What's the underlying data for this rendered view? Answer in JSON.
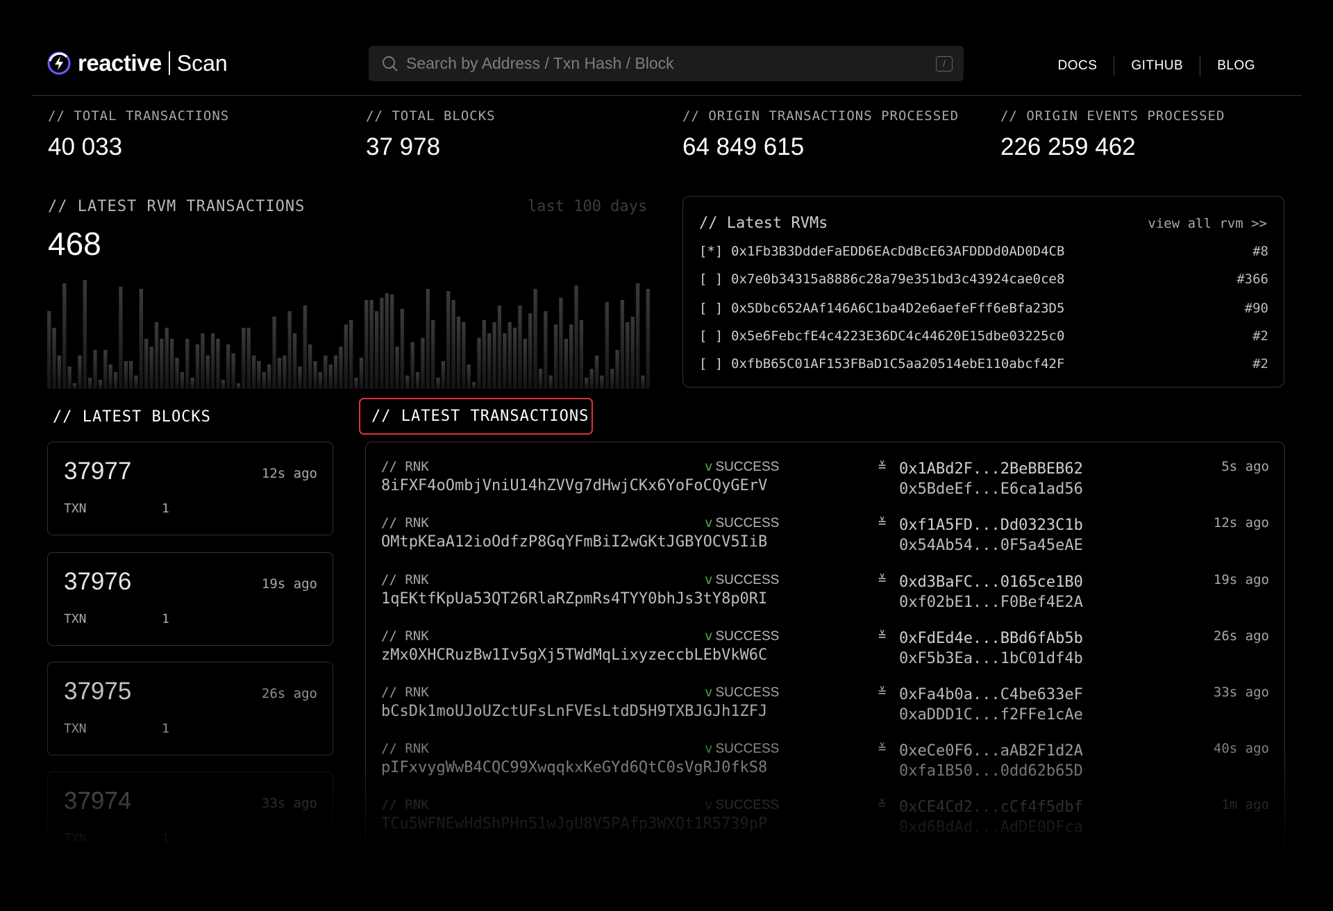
{
  "brand": {
    "name": "reactive",
    "product": "Scan"
  },
  "search": {
    "placeholder": "Search by Address / Txn Hash / Block",
    "shortcut": "/"
  },
  "nav": [
    "DOCS",
    "GITHUB",
    "BLOG"
  ],
  "stats": [
    {
      "label": "// TOTAL TRANSACTIONS",
      "value": "40 033"
    },
    {
      "label": "// TOTAL BLOCKS",
      "value": "37 978"
    },
    {
      "label": "// ORIGIN TRANSACTIONS PROCESSED",
      "value": "64 849 615"
    },
    {
      "label": "// ORIGIN EVENTS PROCESSED",
      "value": "226 259 462"
    }
  ],
  "rvm_tx": {
    "title": "// LATEST RVM TRANSACTIONS",
    "range": "last 100 days",
    "count": "468",
    "bars": [
      0.7,
      0.55,
      0.3,
      0.95,
      0.2,
      0.05,
      0.3,
      0.98,
      0.1,
      0.35,
      0.08,
      0.35,
      0.22,
      0.15,
      0.92,
      0.25,
      0.25,
      0.12,
      0.9,
      0.45,
      0.38,
      0.6,
      0.45,
      0.55,
      0.45,
      0.28,
      0.15,
      0.45,
      0.1,
      0.4,
      0.5,
      0.3,
      0.5,
      0.45,
      0.08,
      0.4,
      0.32,
      0.05,
      0.55,
      0.55,
      0.3,
      0.25,
      0.15,
      0.22,
      0.65,
      0.28,
      0.3,
      0.7,
      0.5,
      0.2,
      0.75,
      0.4,
      0.25,
      0.15,
      0.3,
      0.22,
      0.3,
      0.38,
      0.58,
      0.62,
      0.1,
      0.28,
      0.8,
      0.8,
      0.7,
      0.82,
      0.86,
      0.85,
      0.38,
      0.72,
      0.12,
      0.42,
      0.15,
      0.46,
      0.9,
      0.62,
      0.1,
      0.25,
      0.88,
      0.8,
      0.65,
      0.6,
      0.22,
      0.06,
      0.46,
      0.62,
      0.5,
      0.6,
      0.75,
      0.5,
      0.6,
      0.55,
      0.75,
      0.45,
      0.68,
      0.9,
      0.18,
      0.7,
      0.12,
      0.58,
      0.82,
      0.45,
      0.58,
      0.93,
      0.62,
      0.1,
      0.18,
      0.3,
      0.12,
      0.78,
      0.18,
      0.35,
      0.8,
      0.6,
      0.65,
      0.95,
      0.12,
      0.9
    ]
  },
  "rvms": {
    "title": "// Latest RVMs",
    "view_all": "view all rvm >>",
    "rows": [
      {
        "mark": "[*]",
        "address": "0x1Fb3B3DddeFaEDD6EAcDdBcE63AFDDDd0AD0D4CB",
        "count": "#8"
      },
      {
        "mark": "[ ]",
        "address": "0x7e0b34315a8886c28a79e351bd3c43924cae0ce8",
        "count": "#366"
      },
      {
        "mark": "[ ]",
        "address": "0x5Dbc652AAf146A6C1ba4D2e6aefeFff6eBfa23D5",
        "count": "#90"
      },
      {
        "mark": "[ ]",
        "address": "0x5e6FebcfE4c4223E36DC4c44620E15dbe03225c0",
        "count": "#2"
      },
      {
        "mark": "[ ]",
        "address": "0xfbB65C01AF153FBaD1C5aa20514ebE110abcf42F",
        "count": "#2"
      }
    ]
  },
  "latest_blocks": {
    "title": "// LATEST BLOCKS",
    "txn_label": "TXN",
    "items": [
      {
        "number": "37977",
        "ago": "12s ago",
        "txn": "1"
      },
      {
        "number": "37976",
        "ago": "19s ago",
        "txn": "1"
      },
      {
        "number": "37975",
        "ago": "26s ago",
        "txn": "1"
      },
      {
        "number": "37974",
        "ago": "33s ago",
        "txn": "1"
      }
    ]
  },
  "latest_tx": {
    "title": "// LATEST TRANSACTIONS",
    "items": [
      {
        "net": "// RNK",
        "hash": "8iFXF4oOmbjVniU14hZVVg7dHwjCKx6YoFoCQyGErV",
        "status": "SUCCESS",
        "from": "0x1ABd2F...2BeBBEB62",
        "to": "0x5BdeEf...E6ca1ad56",
        "ago": "5s ago"
      },
      {
        "net": "// RNK",
        "hash": "OMtpKEaA12ioOdfzP8GqYFmBiI2wGKtJGBYOCV5IiB",
        "status": "SUCCESS",
        "from": "0xf1A5FD...Dd0323C1b",
        "to": "0x54Ab54...0F5a45eAE",
        "ago": "12s ago"
      },
      {
        "net": "// RNK",
        "hash": "1qEKtfKpUa53QT26RlaRZpmRs4TYY0bhJs3tY8p0RI",
        "status": "SUCCESS",
        "from": "0xd3BaFC...0165ce1B0",
        "to": "0xf02bE1...F0Bef4E2A",
        "ago": "19s ago"
      },
      {
        "net": "// RNK",
        "hash": "zMx0XHCRuzBw1Iv5gXj5TWdMqLixyzeccbLEbVkW6C",
        "status": "SUCCESS",
        "from": "0xFdEd4e...BBd6fAb5b",
        "to": "0xF5b3Ea...1bC01df4b",
        "ago": "26s ago"
      },
      {
        "net": "// RNK",
        "hash": "bCsDk1moUJoUZctUFsLnFVEsLtdD5H9TXBJGJh1ZFJ",
        "status": "SUCCESS",
        "from": "0xFa4b0a...C4be633eF",
        "to": "0xaDDD1C...f2FFe1cAe",
        "ago": "33s ago"
      },
      {
        "net": "// RNK",
        "hash": "pIFxvygWwB4CQC99XwqqkxKeGYd6QtC0sVgRJ0fkS8",
        "status": "SUCCESS",
        "from": "0xeCe0F6...aAB2F1d2A",
        "to": "0xfa1B50...0dd62b65D",
        "ago": "40s ago"
      },
      {
        "net": "// RNK",
        "hash": "TCu5WFNEwHdShPHn51wJgU8V5PAfp3WXQt1R5739pP",
        "status": "SUCCESS",
        "from": "0xCE4Cd2...cCf4f5dbf",
        "to": "0xd6BdAd...AdDE0DFca",
        "ago": "1m ago"
      }
    ]
  },
  "colors": {
    "accent": "#e0303a",
    "success": "#4caf50",
    "logo": "#6a5cff"
  }
}
